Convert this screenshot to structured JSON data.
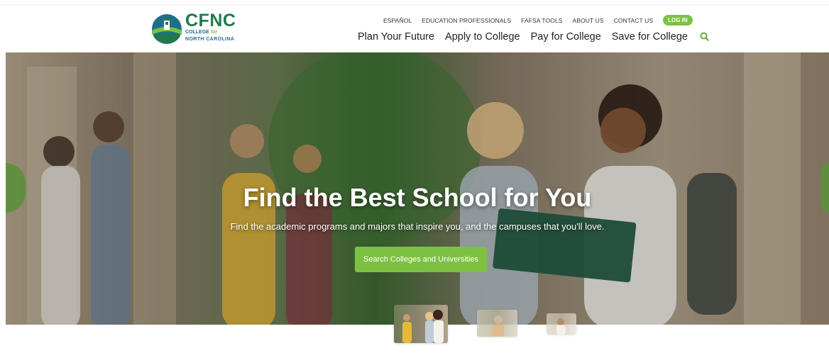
{
  "logo": {
    "abbr": "CFNC",
    "line1_a": "COLLEGE",
    "line1_b": "for",
    "line2": "NORTH CAROLINA"
  },
  "utility_nav": [
    "ESPAÑOL",
    "EDUCATION PROFESSIONALS",
    "FAFSA TOOLS",
    "ABOUT US",
    "CONTACT US"
  ],
  "login_label": "LOG IN",
  "main_nav": [
    "Plan Your Future",
    "Apply to College",
    "Pay for College",
    "Save for College"
  ],
  "hero": {
    "title": "Find the Best School for You",
    "subtitle": "Find the academic programs and majors that inspire you, and the campuses that you'll love.",
    "button": "Search Colleges and Universities"
  },
  "icons": {
    "search": "search-icon",
    "prev": "chevron-left-icon",
    "next": "chevron-right-icon"
  },
  "colors": {
    "brand_green": "#7dc142",
    "brand_dark_green": "#1e7a4e",
    "brand_blue": "#1f6f8b"
  },
  "carousel": {
    "slide_count": 3,
    "active_slide": 1
  }
}
